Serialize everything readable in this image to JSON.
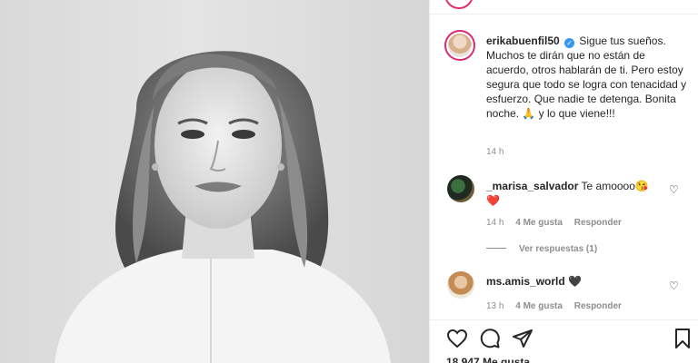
{
  "post": {
    "username": "erikabuenfil50",
    "caption": "Sigue tus sueños. Muchos te dirán que no están de acuerdo, otros hablarán de ti. Pero estoy segura que todo se logra con tenacidad y esfuerzo. Que nadie te detenga. Bonita noche. 🙏 y lo que viene!!!",
    "time": "14 h",
    "likes": "18.947 Me gusta"
  },
  "comments": [
    {
      "username": "_marisa_salvador",
      "text": "Te amoooo😘",
      "emoji_line": "❤️",
      "time": "14 h",
      "likes": "4 Me gusta",
      "reply": "Responder",
      "view_replies": "Ver respuestas (1)"
    },
    {
      "username": "ms.amis_world",
      "text": "🖤",
      "time": "13 h",
      "likes": "4 Me gusta",
      "reply": "Responder"
    }
  ],
  "icons": {
    "like": "heart-icon",
    "comment": "comment-icon",
    "share": "share-icon",
    "save": "bookmark-icon",
    "verified": "verified-badge-icon"
  },
  "colors": {
    "verified": "#3897f0",
    "story_ring": "#d62976",
    "meta": "#8e8e8e"
  }
}
